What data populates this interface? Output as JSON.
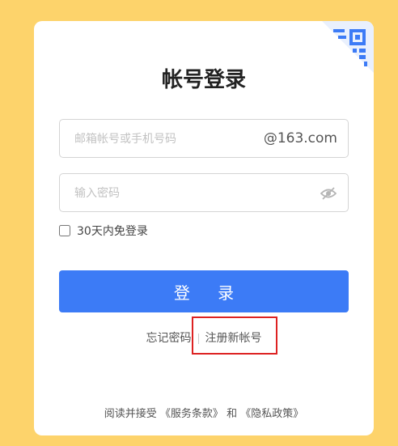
{
  "login": {
    "title": "帐号登录",
    "email_placeholder": "邮箱帐号或手机号码",
    "email_domain": "@163.com",
    "password_placeholder": "输入密码",
    "remember_label": "30天内免登录",
    "login_button": "登 录",
    "forgot_password": "忘记密码",
    "register": "注册新帐号"
  },
  "agreement": {
    "prefix": "阅读并接受",
    "terms": "《服务条款》",
    "and": "和",
    "privacy": "《隐私政策》"
  },
  "icons": {
    "qr": "qr-code-icon",
    "eye": "eye-hidden-icon"
  },
  "colors": {
    "background": "#fdd36b",
    "primary": "#3c7bf6",
    "highlight": "#dd2222"
  }
}
